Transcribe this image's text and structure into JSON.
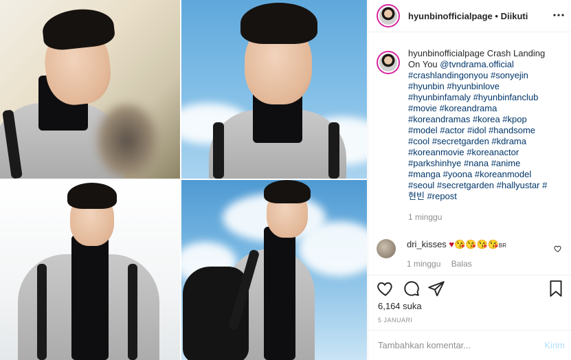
{
  "header": {
    "username": "hyunbinofficialpage",
    "separator": "•",
    "follow_status": "Diikuti"
  },
  "caption": {
    "username": "hyunbinofficialpage",
    "text": "Crash Landing On You",
    "mention": "@tvndrama.official",
    "hashtags": "#crashlandingonyou #sonyejin #hyunbin #hyunbinlove #hyunbinfamaly #hyunbinfanclub #movie #koreandrama #koreandramas #korea #kpop #model #actor #idol #handsome #cool #secretgarden #kdrama #koreanmovie #koreanactor #parkshinhye #nana #anime #manga #yoona #koreanmodel #seoul #secretgarden #hallyustar #현빈 #repost",
    "time": "1 minggu"
  },
  "comment": {
    "username": "dri_kisses",
    "heart": "♥",
    "emojis": "😘😘😘😘",
    "emoji_suffix": "BR",
    "time": "1 minggu",
    "reply_label": "Balas"
  },
  "actions": {
    "like_icon": "heart-icon",
    "comment_icon": "comment-icon",
    "share_icon": "send-icon",
    "save_icon": "bookmark-icon"
  },
  "likes": "6,164 suka",
  "date": "5 JANUARI",
  "add_comment": {
    "placeholder": "Tambahkan komentar...",
    "post_label": "Kirim"
  },
  "colors": {
    "avatar_ring": "#d6249f",
    "hashtag": "#003569",
    "meta_gray": "#8e8e8e",
    "post_button_disabled": "#b2dffc"
  }
}
